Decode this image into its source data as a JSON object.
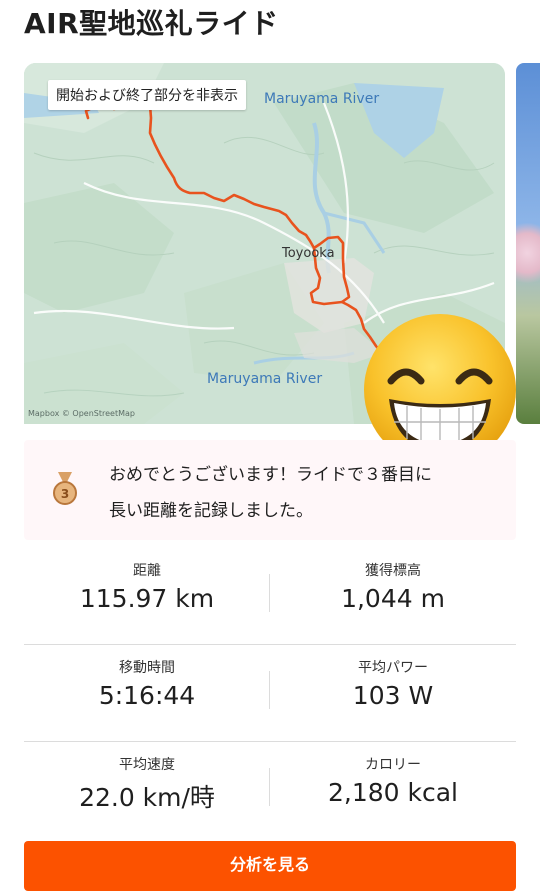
{
  "activity": {
    "title": "AIR聖地巡礼ライド"
  },
  "map": {
    "hide_start_end_chip": "開始および終了部分を非表示",
    "labels": {
      "river_top": "Maruyama River",
      "town": "Toyooka",
      "river_bottom": "Maruyama River"
    },
    "attribution": "Mapbox © OpenStreetMap",
    "route_color": "#e8531e"
  },
  "overlay": {
    "emoji_icon": "grinning-face-emoji"
  },
  "achievement": {
    "medal_icon": "bronze-medal-icon",
    "medal_number": "3",
    "line1": "おめでとうございます！ライドで３番目に",
    "line2": "長い距離を記録しました。"
  },
  "stats": [
    [
      {
        "label": "距離",
        "value": "115.97 km"
      },
      {
        "label": "獲得標高",
        "value": "1,044 m"
      }
    ],
    [
      {
        "label": "移動時間",
        "value": "5:16:44"
      },
      {
        "label": "平均パワー",
        "value": "103 W"
      }
    ],
    [
      {
        "label": "平均速度",
        "value": "22.0 km/時"
      },
      {
        "label": "カロリー",
        "value": "2,180 kcal"
      }
    ]
  ],
  "cta": {
    "label": "分析を見る",
    "color": "#fc5200"
  }
}
